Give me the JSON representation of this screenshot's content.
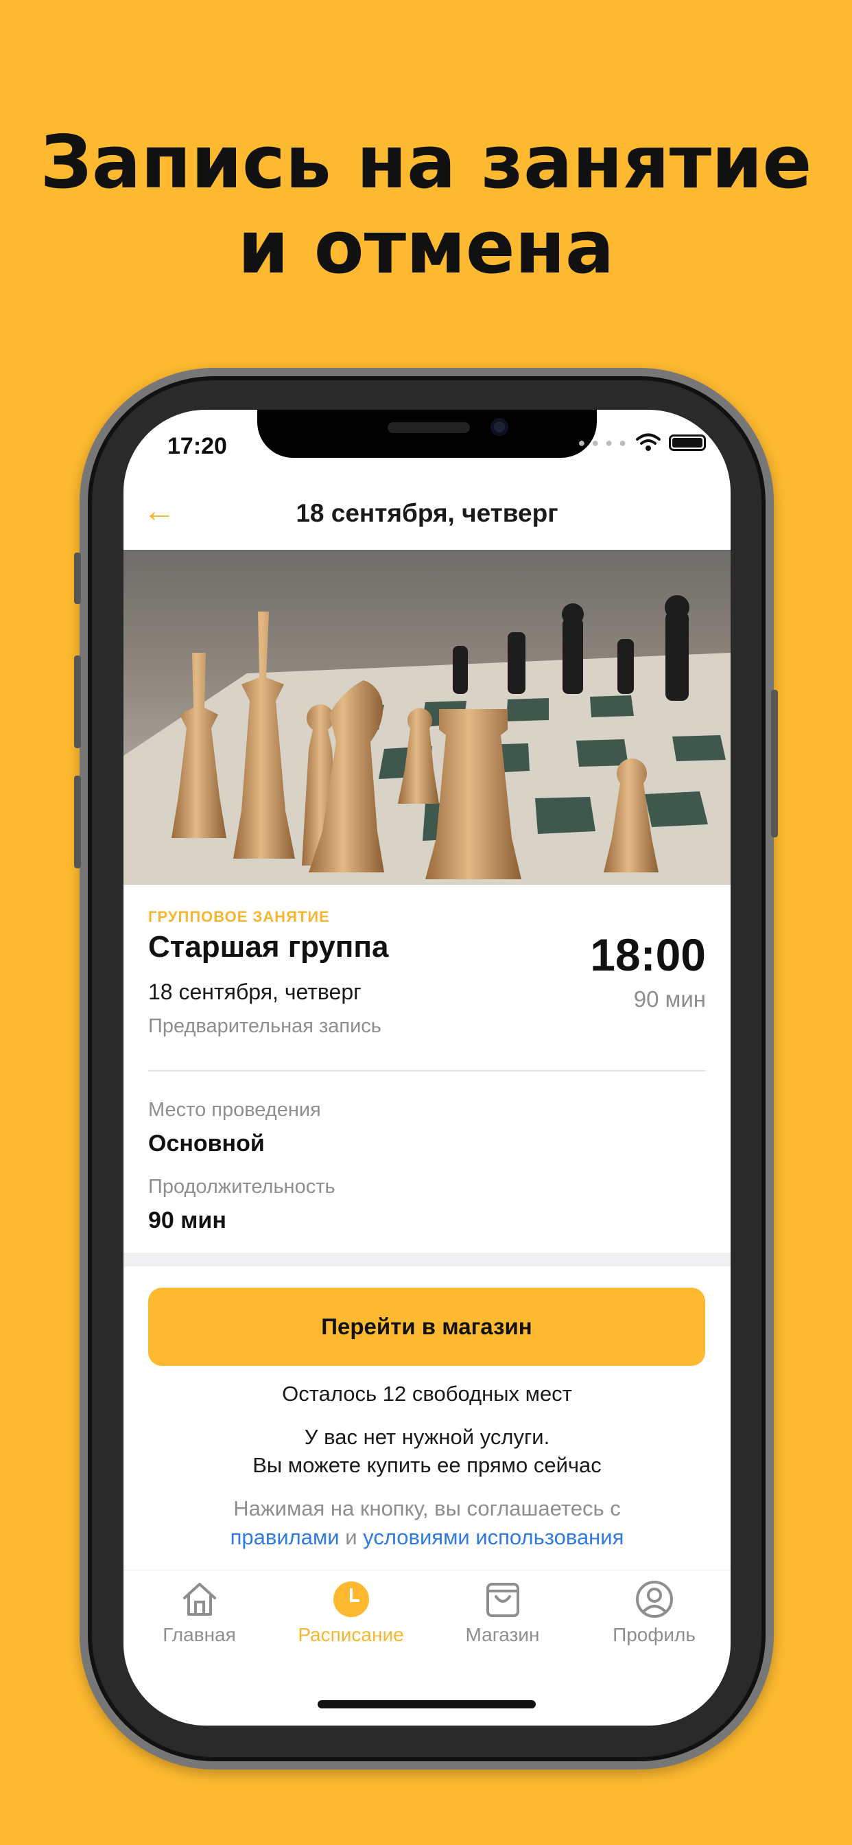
{
  "headline": {
    "line1": "Запись на занятие",
    "line2": "и отмена"
  },
  "status_bar": {
    "time": "17:20",
    "icons": [
      "signal-dots",
      "wifi-icon",
      "battery-icon"
    ]
  },
  "nav": {
    "back_icon": "arrow-left-icon",
    "title": "18 сентября, четверг"
  },
  "class": {
    "type": "ГРУППОВОЕ ЗАНЯТИЕ",
    "name": "Старшая группа",
    "date": "18 сентября, четверг",
    "booking_mode": "Предварительная запись",
    "time": "18:00",
    "duration_short": "90 мин"
  },
  "details": {
    "location_label": "Место проведения",
    "location_value": "Основной",
    "duration_label": "Продолжительность",
    "duration_value": "90 мин"
  },
  "actions": {
    "shop_button": "Перейти в магазин",
    "seats_left": "Осталось 12 свободных мест",
    "no_service_line1": "У вас нет нужной услуги.",
    "no_service_line2": "Вы можете купить ее прямо сейчас",
    "terms_prefix": "Нажимая на кнопку, вы соглашаетесь с",
    "terms_link1": "правилами",
    "terms_and": "и",
    "terms_link2": "условиями использования"
  },
  "tabs": [
    {
      "label": "Главная",
      "icon": "home-icon",
      "active": false
    },
    {
      "label": "Расписание",
      "icon": "clock-icon",
      "active": true
    },
    {
      "label": "Магазин",
      "icon": "bag-icon",
      "active": false
    },
    {
      "label": "Профиль",
      "icon": "profile-icon",
      "active": false
    }
  ],
  "colors": {
    "accent": "#FDB92F",
    "link": "#2F7BE0",
    "muted": "#8E8E8E"
  }
}
